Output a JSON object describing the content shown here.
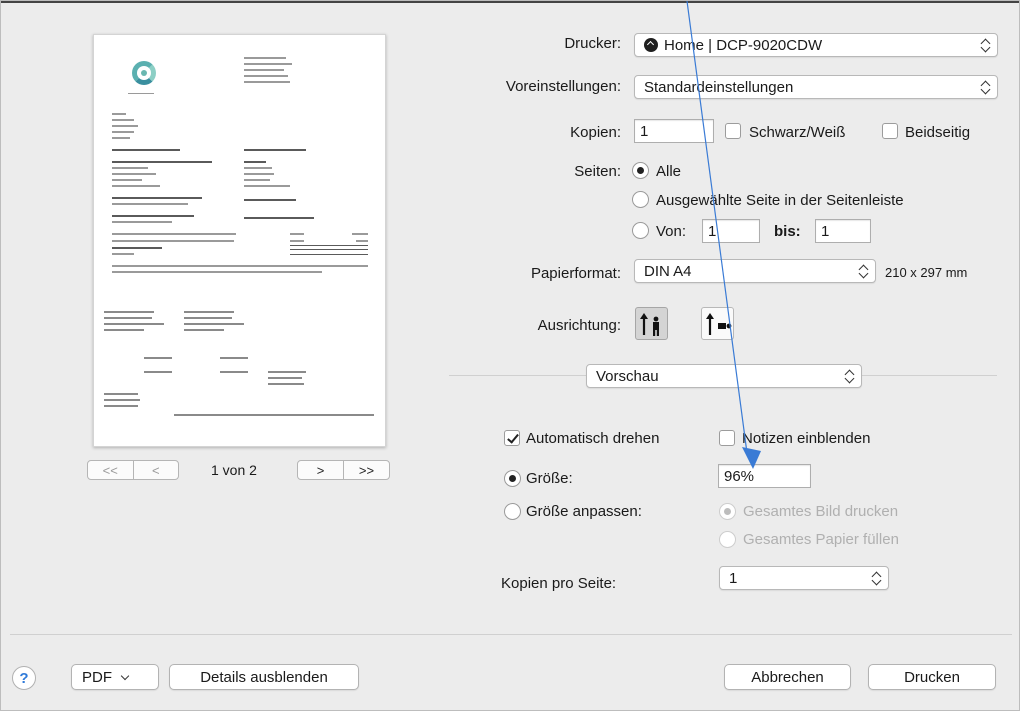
{
  "printer": {
    "label": "Drucker:",
    "value": "Home | DCP-9020CDW",
    "icon": "printer-status-icon"
  },
  "presets": {
    "label": "Voreinstellungen:",
    "value": "Standardeinstellungen"
  },
  "copies": {
    "label": "Kopien:",
    "value": "1",
    "bw_label": "Schwarz/Weiß",
    "duplex_label": "Beidseitig"
  },
  "pages": {
    "label": "Seiten:",
    "all_label": "Alle",
    "selected_label": "Ausgewählte Seite in der Seitenleiste",
    "from_label": "Von:",
    "from_value": "1",
    "to_label": "bis:",
    "to_value": "1",
    "selected_option": "all"
  },
  "paper": {
    "label": "Papierformat:",
    "value": "DIN A4",
    "dimensions": "210 x 297 mm"
  },
  "orientation": {
    "label": "Ausrichtung:",
    "selected": "portrait",
    "portrait_icon": "portrait-orientation-icon",
    "landscape_icon": "landscape-orientation-icon"
  },
  "section": {
    "value": "Vorschau"
  },
  "preview_options": {
    "auto_rotate_label": "Automatisch drehen",
    "auto_rotate_checked": true,
    "notes_label": "Notizen einblenden",
    "notes_checked": false,
    "size_label": "Größe:",
    "size_value": "96%",
    "scale_to_fit_label": "Größe anpassen:",
    "print_entire_image_label": "Gesamtes Bild drucken",
    "fill_entire_paper_label": "Gesamtes Papier füllen",
    "scale_mode": "size"
  },
  "pages_per_sheet": {
    "label": "Kopien pro Seite:",
    "value": "1"
  },
  "preview_nav": {
    "first": "<<",
    "prev": "<",
    "next": ">",
    "last": ">>",
    "indicator": "1 von 2"
  },
  "footer": {
    "help": "?",
    "pdf": "PDF",
    "details": "Details ausblenden",
    "cancel": "Abbrechen",
    "print": "Drucken"
  },
  "colors": {
    "accent": "#2f7ad9",
    "annotation_arrow": "#3a7bd5",
    "dialog_bg": "#ececec"
  }
}
